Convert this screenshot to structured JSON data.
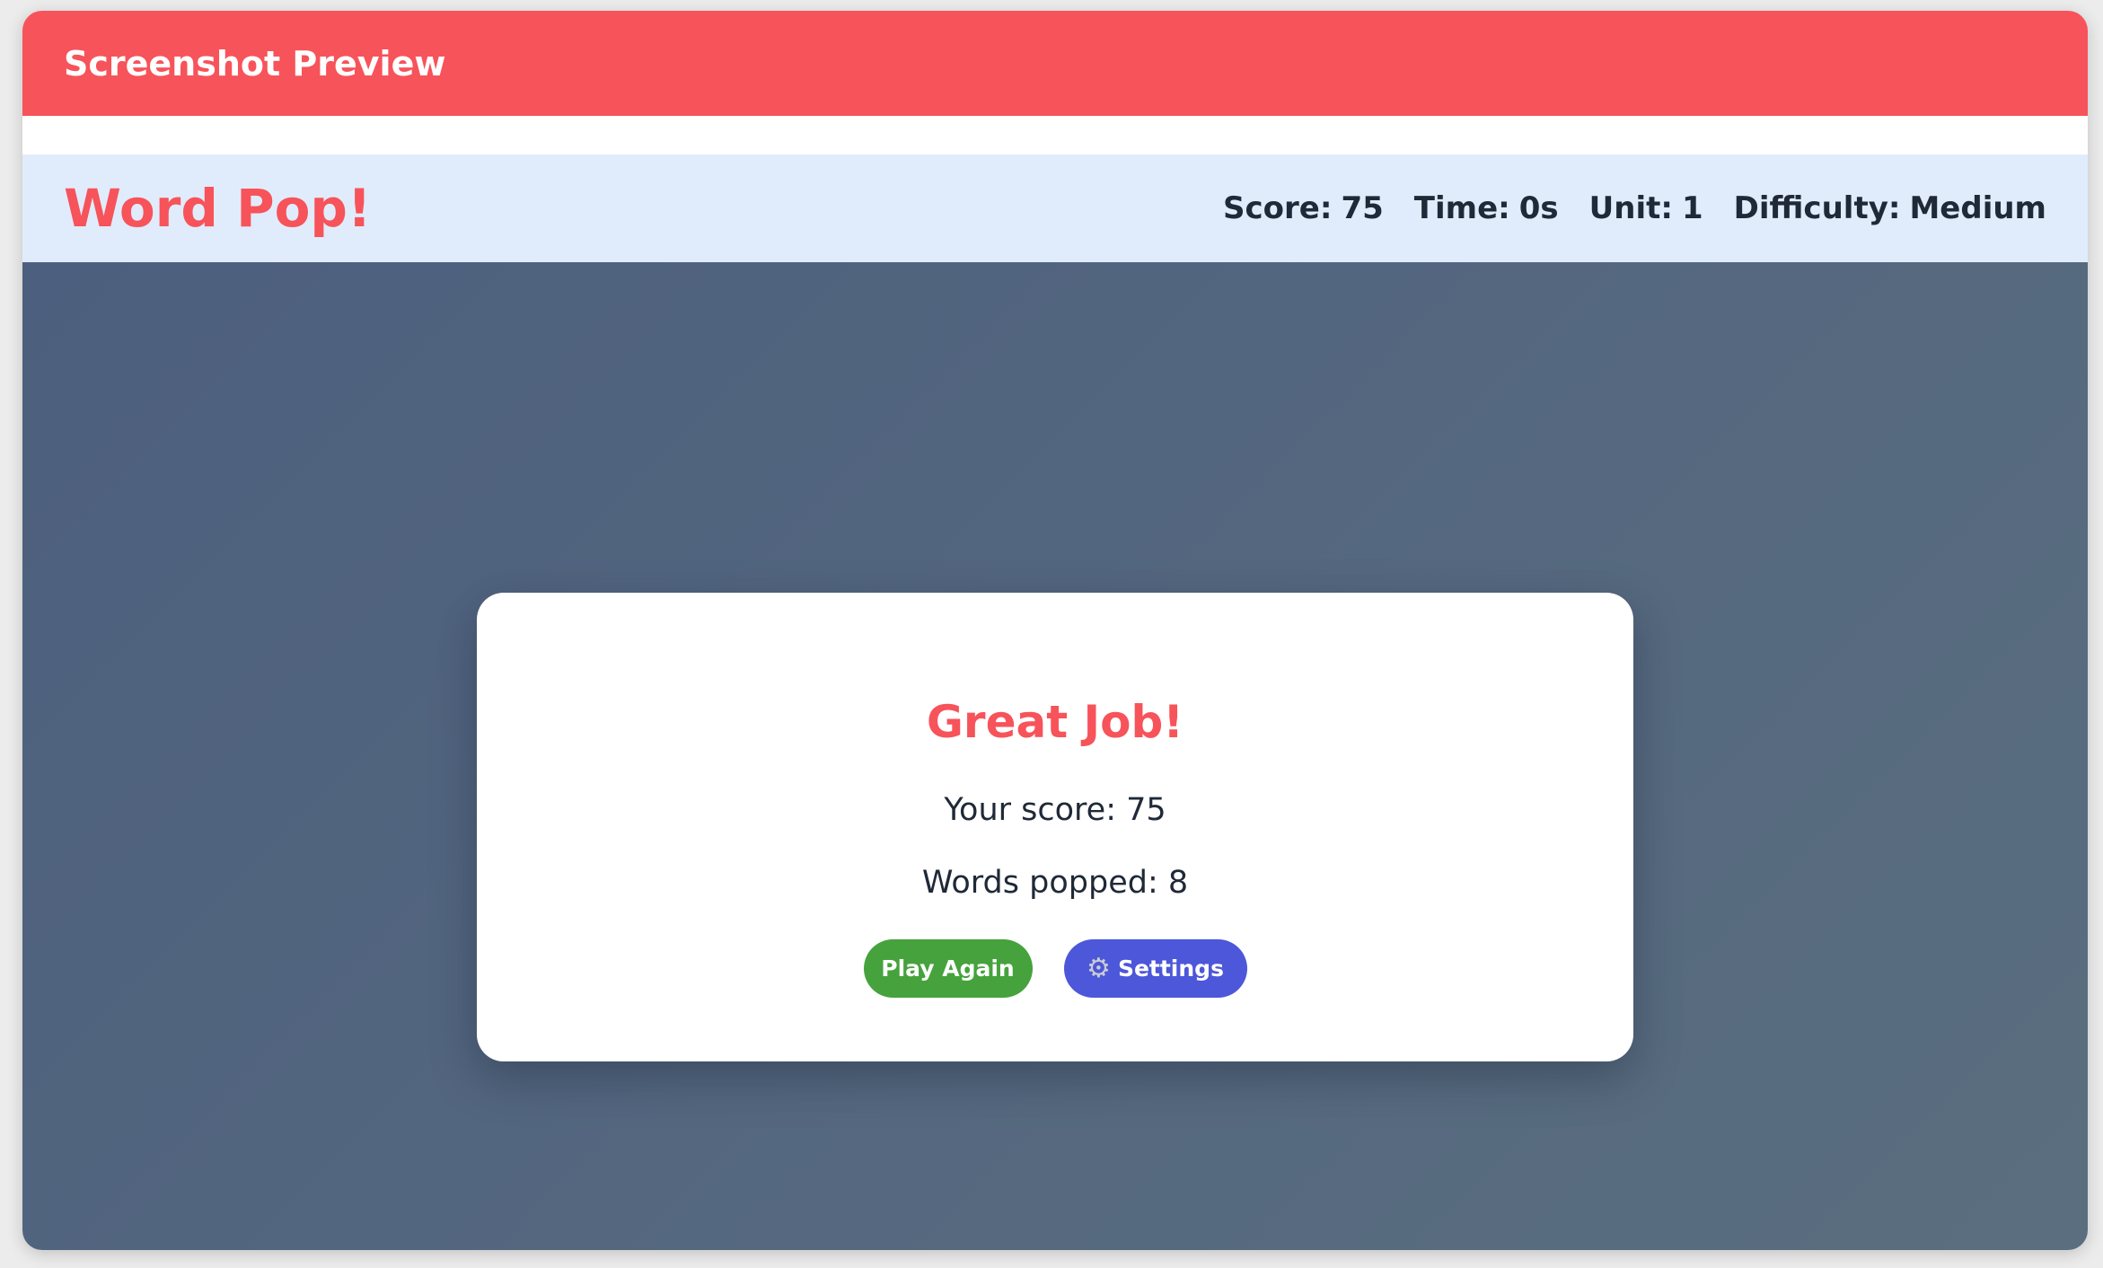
{
  "window": {
    "title": "Screenshot Preview"
  },
  "header": {
    "title": "Word Pop!",
    "stats": [
      {
        "label": "Score:",
        "value": "75"
      },
      {
        "label": "Time:",
        "value": "0s"
      },
      {
        "label": "Unit:",
        "value": "1"
      },
      {
        "label": "Difficulty:",
        "value": "Medium"
      }
    ]
  },
  "modal": {
    "title": "Great Job!",
    "score_label": "Your score:",
    "score_value": "75",
    "words_label": "Words popped:",
    "words_value": "8",
    "play_again_label": "Play Again",
    "settings_label": "Settings",
    "settings_icon": "gear-icon"
  },
  "colors": {
    "accent": "#f7535a",
    "header_bg": "#e0ecfc",
    "play_bg": "#4c5f7e",
    "play_again_button": "#46a23d",
    "settings_button": "#4c57d9"
  }
}
